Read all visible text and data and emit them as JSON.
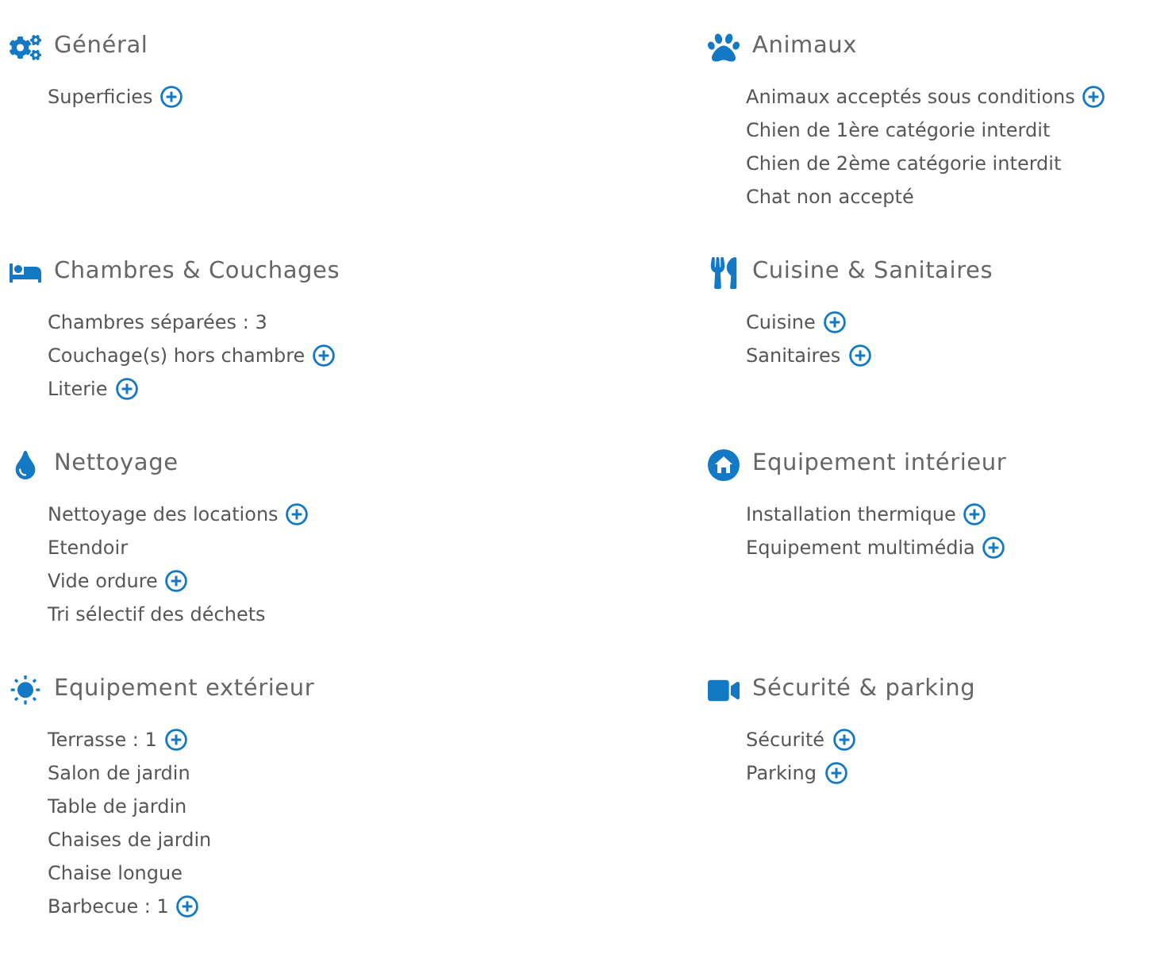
{
  "sections": [
    {
      "title": "Général",
      "items": [
        {
          "label": "Superficies",
          "details": true
        }
      ]
    },
    {
      "title": "Animaux",
      "items": [
        {
          "label": "Animaux acceptés sous conditions",
          "details": true
        },
        {
          "label": "Chien de 1ère catégorie interdit",
          "details": false
        },
        {
          "label": "Chien de 2ème catégorie interdit",
          "details": false
        },
        {
          "label": "Chat non accepté",
          "details": false
        }
      ]
    },
    {
      "title": "Chambres & Couchages",
      "items": [
        {
          "label": "Chambres séparées : 3",
          "details": false
        },
        {
          "label": "Couchage(s) hors chambre",
          "details": true
        },
        {
          "label": "Literie",
          "details": true
        }
      ]
    },
    {
      "title": "Cuisine & Sanitaires",
      "items": [
        {
          "label": "Cuisine",
          "details": true
        },
        {
          "label": "Sanitaires",
          "details": true
        }
      ]
    },
    {
      "title": "Nettoyage",
      "items": [
        {
          "label": "Nettoyage des locations",
          "details": true
        },
        {
          "label": "Etendoir",
          "details": false
        },
        {
          "label": "Vide ordure",
          "details": true
        },
        {
          "label": "Tri sélectif des déchets",
          "details": false
        }
      ]
    },
    {
      "title": "Equipement intérieur",
      "items": [
        {
          "label": "Installation thermique",
          "details": true
        },
        {
          "label": "Equipement multimédia",
          "details": true
        }
      ]
    },
    {
      "title": "Equipement extérieur",
      "items": [
        {
          "label": "Terrasse : 1",
          "details": true
        },
        {
          "label": "Salon de jardin",
          "details": false
        },
        {
          "label": "Table de jardin",
          "details": false
        },
        {
          "label": "Chaises de jardin",
          "details": false
        },
        {
          "label": "Chaise longue",
          "details": false
        },
        {
          "label": "Barbecue : 1",
          "details": true
        }
      ]
    },
    {
      "title": "Sécurité & parking",
      "items": [
        {
          "label": "Sécurité",
          "details": true
        },
        {
          "label": "Parking",
          "details": true
        }
      ]
    }
  ]
}
